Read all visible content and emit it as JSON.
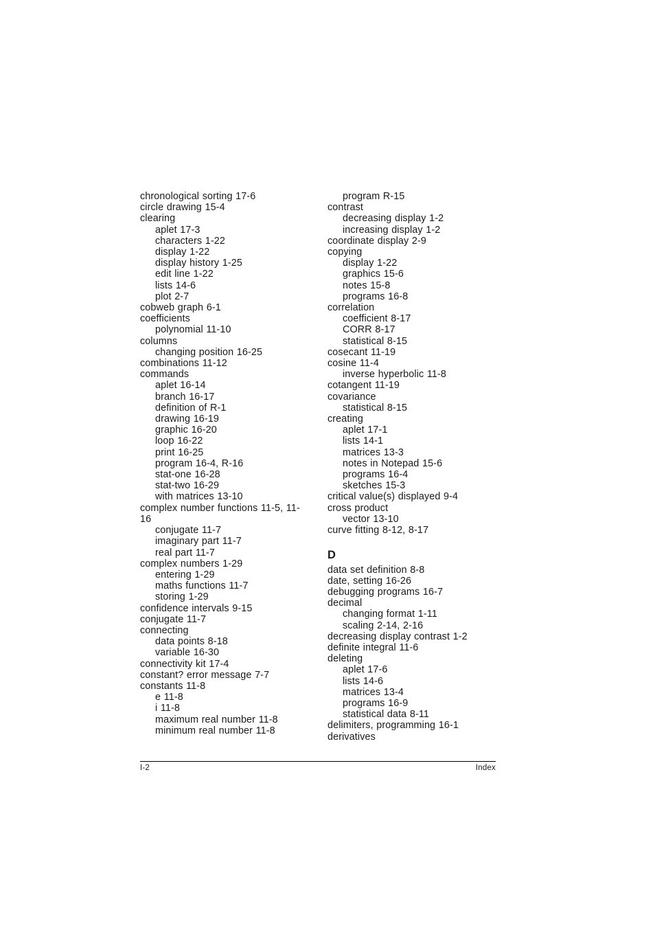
{
  "page": {
    "footer_left": "I-2",
    "footer_right": "Index"
  },
  "index": {
    "columns": [
      {
        "name": "left",
        "blocks": [
          {
            "type": "entries",
            "entries": [
              {
                "level": 1,
                "text": "chronological sorting 17-6"
              },
              {
                "level": 1,
                "text": "circle drawing 15-4"
              },
              {
                "level": 1,
                "text": "clearing"
              },
              {
                "level": 2,
                "text": "aplet 17-3"
              },
              {
                "level": 2,
                "text": "characters 1-22"
              },
              {
                "level": 2,
                "text": "display 1-22"
              },
              {
                "level": 2,
                "text": "display history 1-25"
              },
              {
                "level": 2,
                "text": "edit line 1-22"
              },
              {
                "level": 2,
                "text": "lists 14-6"
              },
              {
                "level": 2,
                "text": "plot 2-7"
              },
              {
                "level": 1,
                "text": "cobweb graph 6-1"
              },
              {
                "level": 1,
                "text": "coefficients"
              },
              {
                "level": 2,
                "text": "polynomial 11-10"
              },
              {
                "level": 1,
                "text": "columns"
              },
              {
                "level": 2,
                "text": "changing position 16-25"
              },
              {
                "level": 1,
                "text": "combinations 11-12"
              },
              {
                "level": 1,
                "text": "commands"
              },
              {
                "level": 2,
                "text": "aplet 16-14"
              },
              {
                "level": 2,
                "text": "branch 16-17"
              },
              {
                "level": 2,
                "text": "definition of R-1"
              },
              {
                "level": 2,
                "text": "drawing 16-19"
              },
              {
                "level": 2,
                "text": "graphic 16-20"
              },
              {
                "level": 2,
                "text": "loop 16-22"
              },
              {
                "level": 2,
                "text": "print 16-25"
              },
              {
                "level": 2,
                "text": "program 16-4, R-16"
              },
              {
                "level": 2,
                "text": "stat-one 16-28"
              },
              {
                "level": 2,
                "text": "stat-two 16-29"
              },
              {
                "level": 2,
                "text": "with matrices 13-10"
              },
              {
                "level": 1,
                "text": "complex number functions 11-5, 11-16"
              },
              {
                "level": 2,
                "text": "conjugate 11-7"
              },
              {
                "level": 2,
                "text": "imaginary part 11-7"
              },
              {
                "level": 2,
                "text": "real part 11-7"
              },
              {
                "level": 1,
                "text": "complex numbers 1-29"
              },
              {
                "level": 2,
                "text": "entering 1-29"
              },
              {
                "level": 2,
                "text": "maths functions 11-7"
              },
              {
                "level": 2,
                "text": "storing 1-29"
              },
              {
                "level": 1,
                "text": "confidence intervals 9-15"
              },
              {
                "level": 1,
                "text": "conjugate 11-7"
              },
              {
                "level": 1,
                "text": "connecting"
              },
              {
                "level": 2,
                "text": "data points 8-18"
              },
              {
                "level": 2,
                "text": "variable 16-30"
              },
              {
                "level": 1,
                "text": "connectivity kit 17-4"
              },
              {
                "level": 1,
                "text": "constant? error message 7-7"
              },
              {
                "level": 1,
                "text": "constants 11-8"
              },
              {
                "level": 2,
                "text": "e 11-8"
              },
              {
                "level": 2,
                "text": "i 11-8"
              },
              {
                "level": 2,
                "text": "maximum real number 11-8"
              },
              {
                "level": 2,
                "text": "minimum real number 11-8"
              }
            ]
          }
        ]
      },
      {
        "name": "right",
        "blocks": [
          {
            "type": "entries",
            "entries": [
              {
                "level": 2,
                "text": "program R-15"
              },
              {
                "level": 1,
                "text": "contrast"
              },
              {
                "level": 2,
                "text": "decreasing display 1-2"
              },
              {
                "level": 2,
                "text": "increasing display 1-2"
              },
              {
                "level": 1,
                "text": "coordinate display 2-9"
              },
              {
                "level": 1,
                "text": "copying"
              },
              {
                "level": 2,
                "text": "display 1-22"
              },
              {
                "level": 2,
                "text": "graphics 15-6"
              },
              {
                "level": 2,
                "text": "notes 15-8"
              },
              {
                "level": 2,
                "text": "programs 16-8"
              },
              {
                "level": 1,
                "text": "correlation"
              },
              {
                "level": 2,
                "text": "coefficient 8-17"
              },
              {
                "level": 2,
                "text": "CORR 8-17"
              },
              {
                "level": 2,
                "text": "statistical 8-15"
              },
              {
                "level": 1,
                "text": "cosecant 11-19"
              },
              {
                "level": 1,
                "text": "cosine 11-4"
              },
              {
                "level": 2,
                "text": "inverse hyperbolic 11-8"
              },
              {
                "level": 1,
                "text": "cotangent 11-19"
              },
              {
                "level": 1,
                "text": "covariance"
              },
              {
                "level": 2,
                "text": "statistical 8-15"
              },
              {
                "level": 1,
                "text": "creating"
              },
              {
                "level": 2,
                "text": "aplet 17-1"
              },
              {
                "level": 2,
                "text": "lists 14-1"
              },
              {
                "level": 2,
                "text": "matrices 13-3"
              },
              {
                "level": 2,
                "text": "notes in Notepad 15-6"
              },
              {
                "level": 2,
                "text": "programs 16-4"
              },
              {
                "level": 2,
                "text": "sketches 15-3"
              },
              {
                "level": 1,
                "text": "critical value(s) displayed 9-4"
              },
              {
                "level": 1,
                "text": "cross product"
              },
              {
                "level": 2,
                "text": "vector 13-10"
              },
              {
                "level": 1,
                "text": "curve fitting 8-12, 8-17"
              }
            ]
          },
          {
            "type": "letter-heading",
            "letter": "D"
          },
          {
            "type": "entries",
            "entries": [
              {
                "level": 1,
                "text": "data set definition 8-8"
              },
              {
                "level": 1,
                "text": "date, setting 16-26"
              },
              {
                "level": 1,
                "text": "debugging programs 16-7"
              },
              {
                "level": 1,
                "text": "decimal"
              },
              {
                "level": 2,
                "text": "changing format 1-11"
              },
              {
                "level": 2,
                "text": "scaling 2-14, 2-16"
              },
              {
                "level": 1,
                "text": "decreasing display contrast 1-2"
              },
              {
                "level": 1,
                "text": "definite integral 11-6"
              },
              {
                "level": 1,
                "text": "deleting"
              },
              {
                "level": 2,
                "text": "aplet 17-6"
              },
              {
                "level": 2,
                "text": "lists 14-6"
              },
              {
                "level": 2,
                "text": "matrices 13-4"
              },
              {
                "level": 2,
                "text": "programs 16-9"
              },
              {
                "level": 2,
                "text": "statistical data 8-11"
              },
              {
                "level": 1,
                "text": "delimiters, programming 16-1"
              },
              {
                "level": 1,
                "text": "derivatives"
              }
            ]
          }
        ]
      }
    ]
  }
}
